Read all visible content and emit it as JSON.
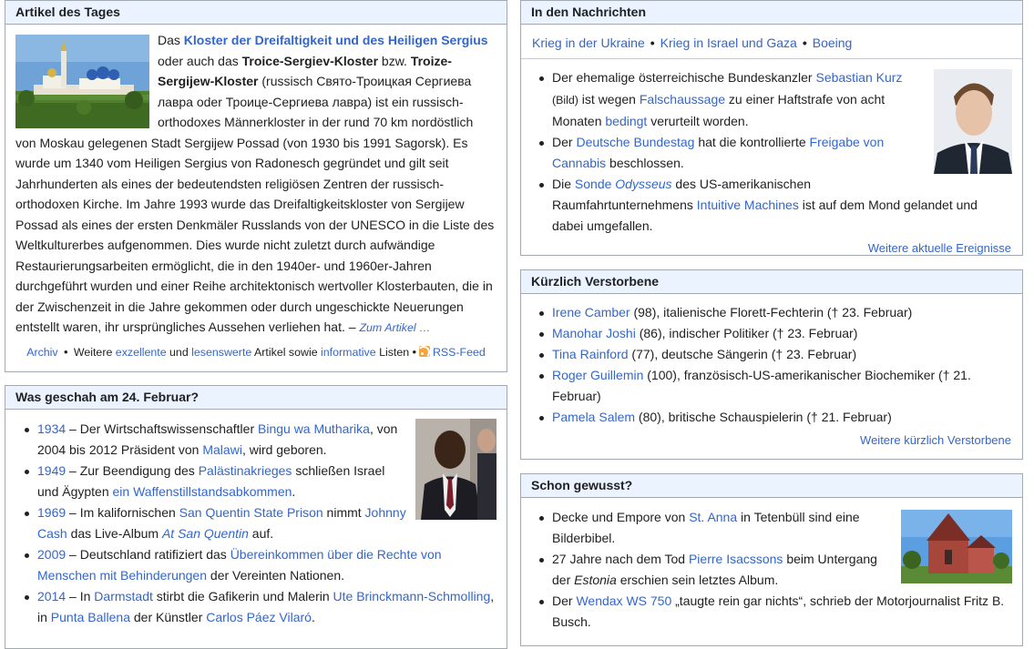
{
  "artikel": {
    "heading": "Artikel des Tages",
    "image_alt": "Kloster der Dreifaltigkeit und des Heiligen Sergius",
    "t1": "Das ",
    "l1": "Kloster der Dreifaltigkeit und des Heiligen Sergius",
    "t2": " oder auch das ",
    "b1": "Troice-Sergiev-Kloster",
    "t3": " bzw. ",
    "b2": "Troize-Sergijew-Kloster",
    "t4": " (russisch Свято-Троицкая Сергиева лавра oder Троице-Сергиева лавра) ist ein russisch-ortho­doxes Männerkloster in der rund 70 km nordöstlich von Moskau gelegenen Stadt Sergijew Possad (von 1930 bis 1991 Sagorsk). Es wurde um 1340 vom Heiligen Sergius von Radonesch gegründet und gilt seit Jahrhun­derten als eines der bedeutendsten religiösen Zentren der russisch-orthodoxen Kirche. Im Jahre 1993 wurde das Dreifaltigkeitskloster von Sergijew Possad als eines der ersten Denkmäler Russlands von der UNESCO in die Liste des Weltkultur­erbes aufgenommen. Dies wurde nicht zuletzt durch aufwändige Restaurierungs­arbeiten ermöglicht, die in den 1940er- und 1960er-Jahren durchgeführt wurden und einer Reihe architektonisch wertvoller Klosterbauten, die in der Zwischenzeit in die Jahre gekommen oder durch ungeschickte Neuerungen entstellt waren, ihr ursprüng­liches Aussehen verliehen hat. – ",
    "more": "Zum Artikel …",
    "footer": {
      "archiv": "Archiv",
      "dot": "•",
      "weitere": " Weitere ",
      "exzellente": "exzellente",
      "und": " und ",
      "lesenswerte": "lesenswerte",
      "artikel_sowie": " Artikel sowie ",
      "informative": "informative",
      "listen": " Listen ",
      "rss": "RSS-Feed"
    }
  },
  "geschah": {
    "heading": "Was geschah am 24. Februar?",
    "items": [
      {
        "year": "1934",
        "a": " – Der Wirtschaftswissenschaftler ",
        "l1": "Bingu wa Mutharika",
        "b": ", von 2004 bis 2012 Präsident von ",
        "l2": "Malawi",
        "c": ", wird geboren."
      },
      {
        "year": "1949",
        "a": " – Zur Beendigung des ",
        "l1": "Palästinakrieges",
        "b": " schließen Israel und Ägypten ",
        "l2": "ein Waffenstillstandsabkommen",
        "c": "."
      },
      {
        "year": "1969",
        "a": " – Im kalifornischen ",
        "l1": "San Quentin State Prison",
        "b": " nimmt ",
        "l2": "Johnny Cash",
        "c": " das Live-Album ",
        "l3": "At San Quentin",
        "d": " auf."
      },
      {
        "year": "2009",
        "a": " – Deutschland ratifiziert das ",
        "l1": "Übereinkommen über die Rechte von Menschen mit Behinderungen",
        "b": " der Vereinten Nationen."
      },
      {
        "year": "2014",
        "a": " – In ",
        "l1": "Darmstadt",
        "b": " stirbt die Gafikerin und Malerin ",
        "l2": "Ute Brinckmann-Schmolling",
        "c": ", in ",
        "l3": "Punta Ballena",
        "d": " der Künstler ",
        "l4": "Carlos Páez Vilaró",
        "e": "."
      }
    ]
  },
  "nachrichten": {
    "heading": "In den Nachrichten",
    "topics": [
      "Krieg in der Ukraine",
      "Krieg in Israel und Gaza",
      "Boeing"
    ],
    "sep": "•",
    "n1": {
      "a": "Der ehemalige österreichische Bundeskanzler ",
      "l1": "Sebastian Kurz",
      "bild": " (Bild)",
      "b": " ist wegen ",
      "l2": "Falschaussage",
      "c": " zu einer Haftstrafe von acht Monaten ",
      "l3": "bedingt",
      "d": " verurteilt worden."
    },
    "n2": {
      "a": "Der ",
      "l1": "Deutsche Bundestag",
      "b": " hat die kontrollierte ",
      "l2": "Freigabe von Cannabis",
      "c": " beschlossen."
    },
    "n3": {
      "a": "Die ",
      "l1": "Sonde ",
      "l1i": "Odysseus",
      "b": " des US-amerikanischen Raumfahrtunternehmens ",
      "l2": "Intuitive Machines",
      "c": " ist auf dem Mond gelandet und dabei umgefallen."
    },
    "more": "Weitere aktuelle Ereignisse"
  },
  "verstorbene": {
    "heading": "Kürzlich Verstorbene",
    "items": [
      {
        "name": "Irene Camber",
        "rest": " (98), italienische Florett-Fechterin († 23. Februar)"
      },
      {
        "name": "Manohar Joshi",
        "rest": " (86), indischer Politiker († 23. Februar)"
      },
      {
        "name": "Tina Rainford",
        "rest": " (77), deutsche Sängerin († 23. Februar)"
      },
      {
        "name": "Roger Guillemin",
        "rest": " (100), französisch-US-amerikanischer Biochemiker († 21. Februar)"
      },
      {
        "name": "Pamela Salem",
        "rest": " (80), britische Schauspielerin († 21. Februar)"
      }
    ],
    "more": "Weitere kürzlich Verstorbene"
  },
  "gewusst": {
    "heading": "Schon gewusst?",
    "g1": {
      "a": "Decke und Empore von ",
      "l1": "St. Anna",
      "b": " in Tetenbüll sind eine Bilderbibel."
    },
    "g2": {
      "a": "27 Jahre nach dem Tod ",
      "l1": "Pierre Isacssons",
      "b": " beim Untergang der ",
      "i": "Estonia",
      "c": " erschien sein letztes Album."
    },
    "g3": {
      "a": "Der ",
      "l1": "Wendax WS 750",
      "b": " „taugte rein gar nichts“, schrieb der Motorjournalist Fritz B. Busch."
    }
  }
}
